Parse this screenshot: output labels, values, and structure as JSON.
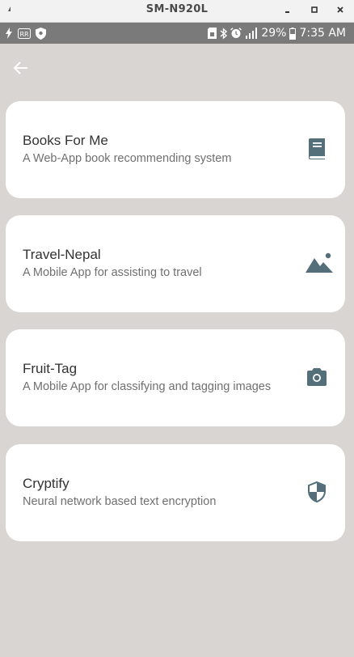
{
  "window": {
    "title": "SM-N920L"
  },
  "status_bar": {
    "battery_percent": "29%",
    "time": "7:35 AM"
  },
  "header": {
    "back_icon": "arrow-left-icon"
  },
  "colors": {
    "background": "#d8d5d3",
    "card": "#ffffff",
    "icon": "#546e7a",
    "status_bar": "#7a7a7a"
  },
  "projects": [
    {
      "title": "Books For Me",
      "subtitle": "A Web-App book recommending system",
      "icon": "book-icon"
    },
    {
      "title": "Travel-Nepal",
      "subtitle": "A Mobile App for assisting to travel",
      "icon": "landscape-icon"
    },
    {
      "title": "Fruit-Tag",
      "subtitle": "A Mobile App for classifying and tagging images",
      "icon": "camera-icon"
    },
    {
      "title": "Cryptify",
      "subtitle": "Neural network based text encryption",
      "icon": "shield-icon"
    }
  ]
}
